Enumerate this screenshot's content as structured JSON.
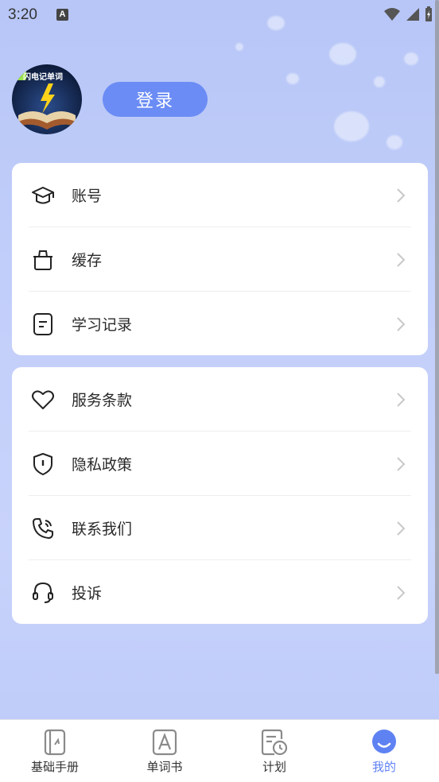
{
  "status_bar": {
    "time": "3:20",
    "notification_badge": "A"
  },
  "header": {
    "avatar_text": "闪电记单词",
    "login_label": "登录"
  },
  "menu_group_1": [
    {
      "label": "账号",
      "icon": "graduation-cap-icon"
    },
    {
      "label": "缓存",
      "icon": "trash-bin-icon"
    },
    {
      "label": "学习记录",
      "icon": "document-icon"
    }
  ],
  "menu_group_2": [
    {
      "label": "服务条款",
      "icon": "heart-icon"
    },
    {
      "label": "隐私政策",
      "icon": "shield-icon"
    },
    {
      "label": "联系我们",
      "icon": "phone-icon"
    },
    {
      "label": "投诉",
      "icon": "headset-icon"
    }
  ],
  "tabs": [
    {
      "label": "基础手册",
      "icon": "notebook-icon"
    },
    {
      "label": "单词书",
      "icon": "letter-a-icon"
    },
    {
      "label": "计划",
      "icon": "clock-plan-icon"
    },
    {
      "label": "我的",
      "icon": "profile-icon",
      "active": true
    }
  ],
  "colors": {
    "accent": "#6b8cf5",
    "active_tab": "#5f82f3",
    "background": "#c3cffa"
  }
}
